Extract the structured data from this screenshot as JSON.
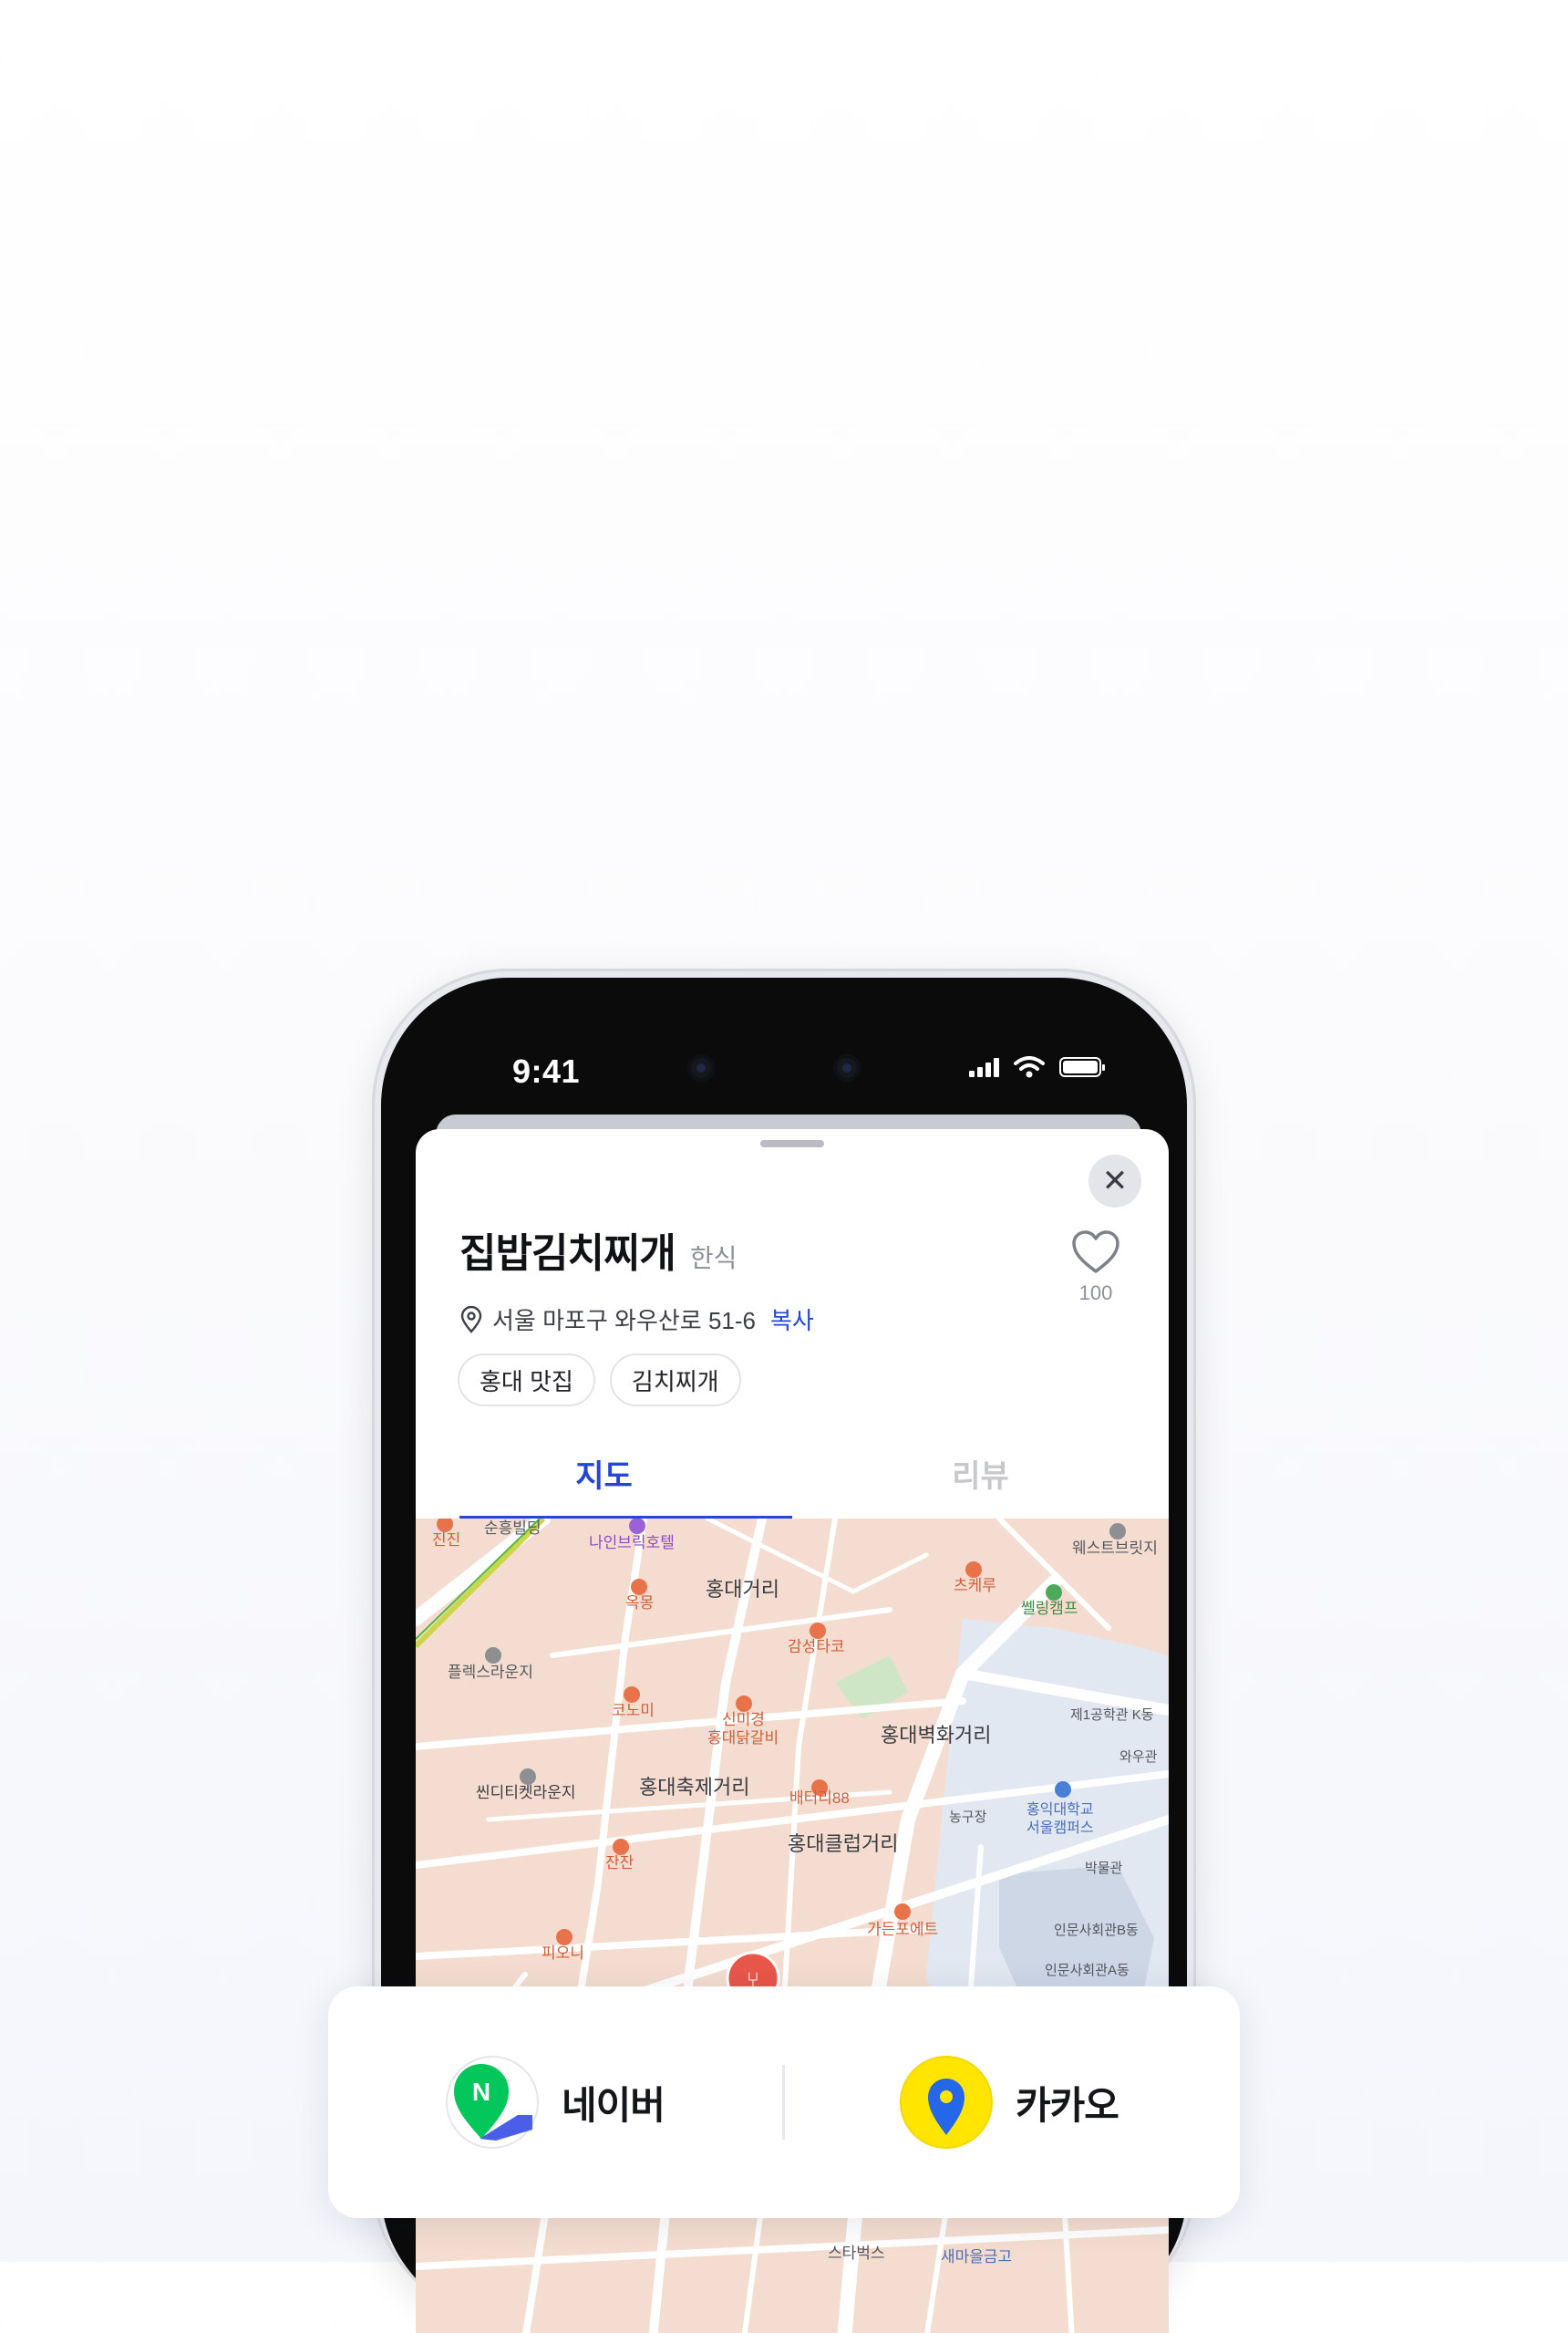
{
  "status_bar": {
    "time": "9:41"
  },
  "sheet": {
    "close_icon": "close-icon",
    "place_name": "집밥김치찌개",
    "category": "한식",
    "like_count": "100",
    "address": "서울 마포구 와우산로 51-6",
    "copy_label": "복사",
    "tags": [
      "홍대 맛집",
      "김치찌개"
    ],
    "tabs": [
      {
        "label": "지도",
        "active": true
      },
      {
        "label": "리뷰",
        "active": false
      }
    ]
  },
  "map": {
    "labels": [
      "진진",
      "순흥빌딩",
      "나인브릭호텔",
      "웨스트브릿지",
      "옥몽",
      "홍대거리",
      "츠케루",
      "쎌링캠프",
      "감성타코",
      "플렉스라운지",
      "코노미",
      "신미경",
      "홍대닭갈비",
      "홍대벽화거리",
      "제1공학관 K동",
      "와우관",
      "씬디티켓라운지",
      "홍대축제거리",
      "배터리88",
      "농구장",
      "홍익대학교",
      "서울캠퍼스",
      "홍대클럽거리",
      "잔잔",
      "박물관",
      "가든포에트",
      "인문사회관B동",
      "피오니",
      "인문사회관A동",
      "스타벅스",
      "새마을금고"
    ]
  },
  "app_choices": {
    "naver_label": "네이버",
    "kakao_label": "카카오"
  },
  "colors": {
    "accent": "#2346d8",
    "kakao_yellow": "#ffe500",
    "naver_green": "#03c75a",
    "poi_orange": "#e8734a"
  }
}
